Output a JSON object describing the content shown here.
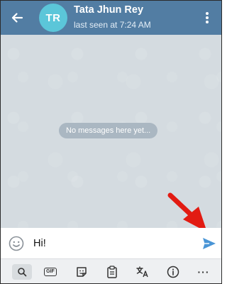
{
  "header": {
    "avatar_initials": "TR",
    "contact_name": "Tata Jhun Rey",
    "status": "last seen at 7:24 AM",
    "icons": [
      "back-arrow-icon",
      "more-vertical-icon"
    ],
    "colors": {
      "bar": "#527da3",
      "avatar": "#5bc6d9"
    }
  },
  "chat": {
    "empty_message": "No messages here yet..."
  },
  "composer": {
    "message_value": "Hi!",
    "icons": [
      "emoji-icon",
      "send-icon"
    ],
    "send_color": "#4a95d6"
  },
  "keyboard_toolbar": {
    "gif_label": "GIF",
    "more_label": "···",
    "icons": [
      "search-icon",
      "gif-icon",
      "sticker-icon",
      "clipboard-icon",
      "translate-icon",
      "info-icon",
      "more-icon"
    ]
  },
  "annotation": {
    "type": "red-arrow",
    "color": "#e21b12"
  }
}
